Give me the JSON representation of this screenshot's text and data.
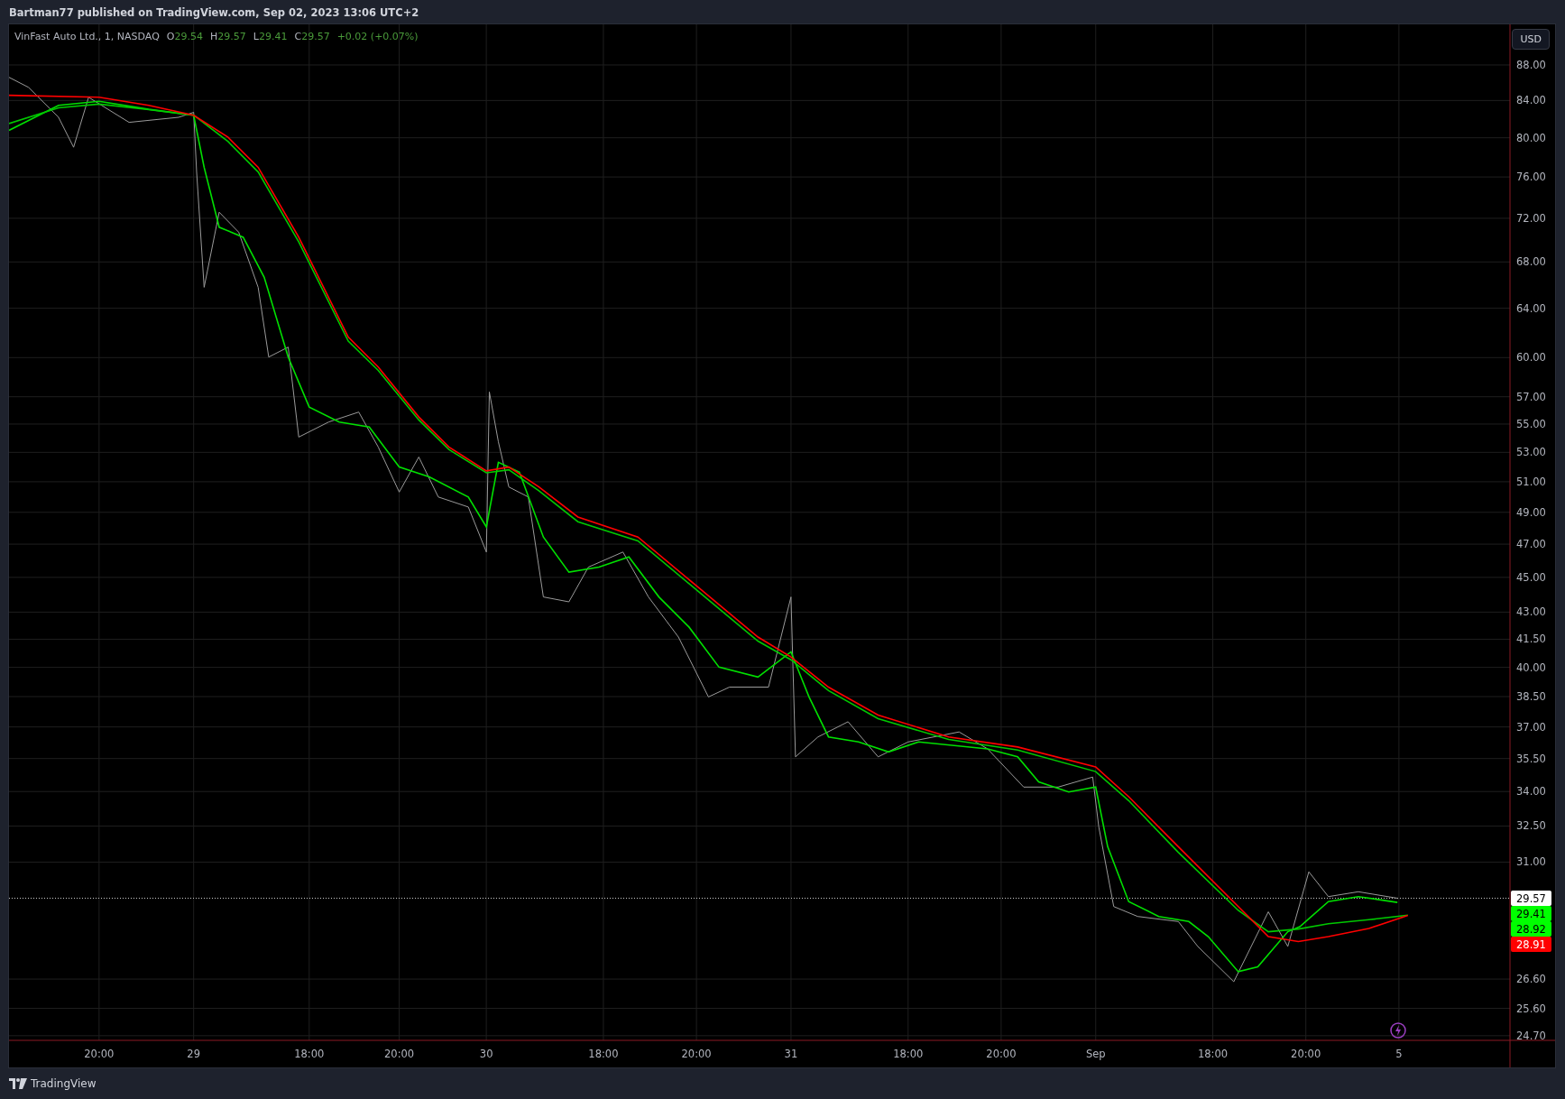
{
  "header": {
    "text": "Bartman77 published on TradingView.com, Sep 02, 2023 13:06 UTC+2"
  },
  "legend": {
    "symbol": "VinFast Auto Ltd., 1, NASDAQ",
    "values": [
      {
        "key": "O",
        "value": "29.54"
      },
      {
        "key": "H",
        "value": "29.57"
      },
      {
        "key": "L",
        "value": "29.41"
      },
      {
        "key": "C",
        "value": "29.57"
      }
    ],
    "change": "+0.02 (+0.07%)"
  },
  "currency_button": {
    "label": "USD"
  },
  "price_axis": [
    "88.00",
    "84.00",
    "80.00",
    "76.00",
    "72.00",
    "68.00",
    "64.00",
    "60.00",
    "57.00",
    "55.00",
    "53.00",
    "51.00",
    "49.00",
    "47.00",
    "45.00",
    "43.00",
    "41.50",
    "40.00",
    "38.50",
    "37.00",
    "35.50",
    "34.00",
    "32.50",
    "31.00",
    "26.60",
    "25.60",
    "24.70"
  ],
  "time_axis": [
    "20:00",
    "29",
    "18:00",
    "20:00",
    "30",
    "18:00",
    "20:00",
    "31",
    "18:00",
    "20:00",
    "Sep",
    "18:00",
    "20:00",
    "5"
  ],
  "last_value_labels": [
    {
      "text": "29.57",
      "color": "#ffffff"
    },
    {
      "text": "29.41",
      "color": "#00ff00"
    },
    {
      "text": "28.92",
      "color": "#00ff00"
    },
    {
      "text": "28.91",
      "color": "#ff0000"
    }
  ],
  "footer": {
    "logo_text": "TradingView"
  }
}
